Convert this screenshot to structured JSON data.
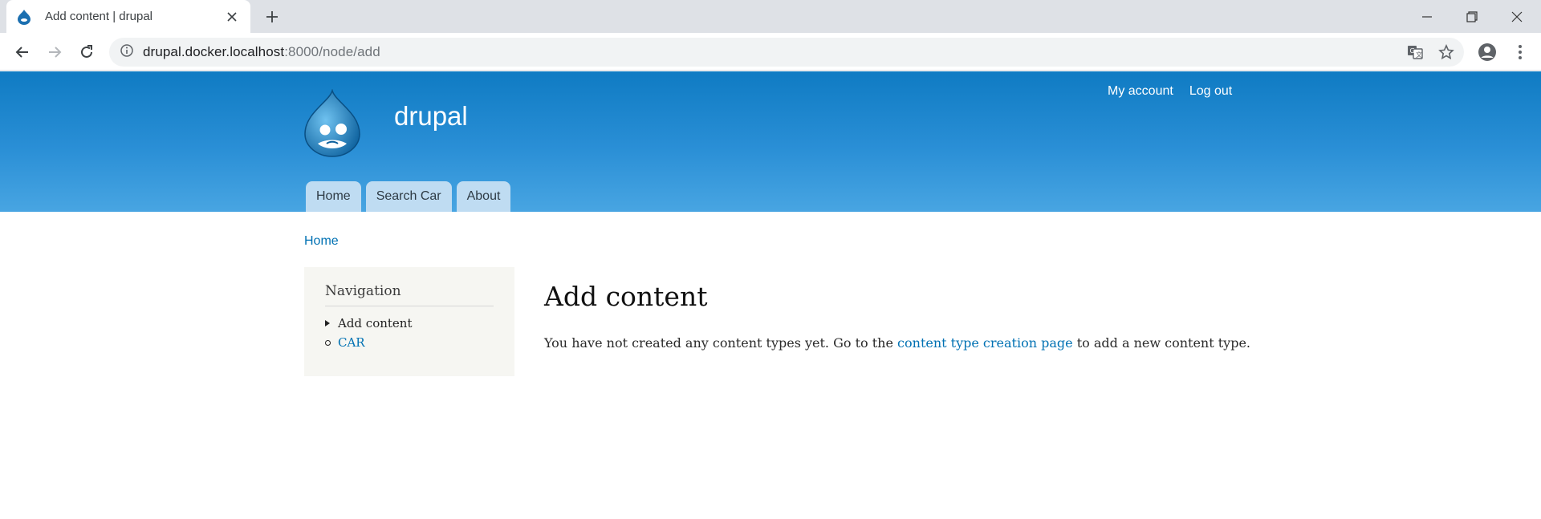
{
  "browser": {
    "tab": {
      "title": "Add content | drupal",
      "favicon": "drupal-drop-icon",
      "close_icon": "close-icon"
    },
    "new_tab_icon": "plus-icon",
    "window_controls": [
      "minimize-icon",
      "restore-icon",
      "close-icon"
    ],
    "nav": {
      "back": "back-arrow-icon",
      "forward": "forward-arrow-icon",
      "reload": "reload-icon"
    },
    "address": {
      "host": "drupal.docker.localhost",
      "path": ":8000/node/add",
      "info_icon": "info-icon"
    },
    "omnibox_icons": [
      "translate-icon",
      "star-icon"
    ],
    "profile_icon": "account-circle-icon",
    "menu_icon": "kebab-menu-icon"
  },
  "header": {
    "site_name": "drupal",
    "logo_icon": "drupal-logo",
    "secondary_menu": [
      "My account",
      "Log out"
    ],
    "main_menu": [
      "Home",
      "Search Car",
      "About"
    ]
  },
  "breadcrumb": "Home",
  "sidebar": {
    "title": "Navigation",
    "items": [
      {
        "label": "Add content",
        "active": true
      },
      {
        "label": "CAR",
        "active": false
      }
    ]
  },
  "main": {
    "title": "Add content",
    "message_before": "You have not created any content types yet. Go to the ",
    "message_link": "content type creation page",
    "message_after": " to add a new content type."
  },
  "colors": {
    "header_top": "#0f7bc3",
    "header_bottom": "#48a5e2",
    "tab_bg": "#bfdcf2",
    "link": "#0071b3",
    "sidebar_bg": "#f6f6f2"
  }
}
